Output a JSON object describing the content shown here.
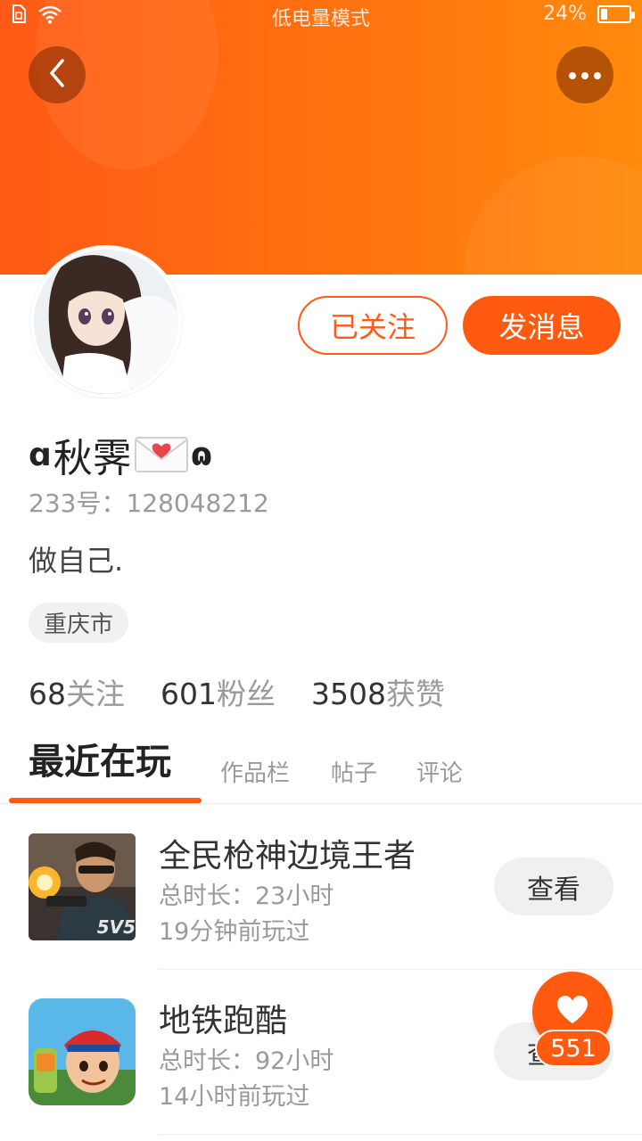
{
  "status_bar": {
    "center_text": "低电量模式",
    "battery_percent": "24%",
    "battery_level": 0.24
  },
  "actions": {
    "follow_label": "已关注",
    "message_label": "发消息"
  },
  "profile": {
    "nickname_prefix": "ɑ",
    "nickname": "秋霁",
    "nickname_suffix": "ɷ",
    "uid_label": "233号：",
    "uid": "128048212",
    "bio": "做自己.",
    "location": "重庆市"
  },
  "stats": [
    {
      "num": "68",
      "label": "关注"
    },
    {
      "num": "601",
      "label": "粉丝"
    },
    {
      "num": "3508",
      "label": "获赞"
    }
  ],
  "tabs": [
    {
      "label": "最近在玩",
      "active": true
    },
    {
      "label": "作品栏",
      "active": false
    },
    {
      "label": "帖子",
      "active": false
    },
    {
      "label": "评论",
      "active": false
    }
  ],
  "games": [
    {
      "title": "全民枪神边境王者",
      "duration": "总时长：23小时",
      "last_played": "19分钟前玩过",
      "button": "查看",
      "icon_text": "5V5"
    },
    {
      "title": "地铁跑酷",
      "duration": "总时长：92小时",
      "last_played": "14小时前玩过",
      "button": "查看"
    }
  ],
  "like": {
    "count": "551"
  },
  "colors": {
    "accent": "#ff5a10",
    "banner_start": "#ff5a16",
    "banner_end": "#ff8a0c"
  }
}
